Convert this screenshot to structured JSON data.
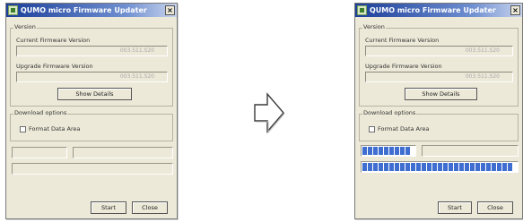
{
  "window": {
    "title": "QUMO micro Firmware Updater",
    "close_glyph": "×",
    "icon": "app-icon"
  },
  "version_group": {
    "legend": "Version",
    "current_label": "Current Firmware Version",
    "current_value": "003.511.S20",
    "upgrade_label": "Upgrade Firmware Version",
    "upgrade_value": "003.511.S20",
    "show_details": "Show Details"
  },
  "download_group": {
    "legend": "Download options",
    "format_label": "Format Data Area",
    "format_checked": false
  },
  "buttons": {
    "start": "Start",
    "close": "Close"
  },
  "after_progress": {
    "segment_bar_fill": 0.4,
    "overall_bar_fill": 1.0
  },
  "colors": {
    "progress": "#3f6ed0",
    "title_bar": "#1b3f9a"
  }
}
